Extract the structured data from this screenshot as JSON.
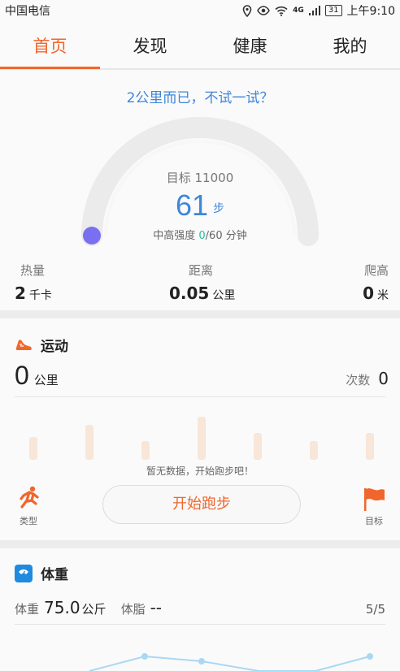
{
  "status_bar": {
    "carrier": "中国电信",
    "network": "4G",
    "calendar_day": "31",
    "time": "上午9:10"
  },
  "tabs": [
    {
      "label": "首页",
      "active": true
    },
    {
      "label": "发现",
      "active": false
    },
    {
      "label": "健康",
      "active": false
    },
    {
      "label": "我的",
      "active": false
    }
  ],
  "steps_card": {
    "hint": "2公里而已，不试一试？",
    "target": "目标 11000",
    "steps": "61",
    "steps_unit": "步",
    "intensity_prefix": "中高强度 ",
    "intensity_value": "0",
    "intensity_suffix": "/60 分钟",
    "progress_fraction": 0.0055
  },
  "metrics": {
    "calories": {
      "label": "热量",
      "value": "2",
      "unit": "千卡"
    },
    "distance": {
      "label": "距离",
      "value": "0.05",
      "unit": "公里"
    },
    "climb": {
      "label": "爬高",
      "value": "0",
      "unit": "米"
    }
  },
  "exercise_card": {
    "title": "运动",
    "distance_value": "0",
    "distance_unit": "公里",
    "count_label": "次数",
    "count_value": "0",
    "no_data": "暂无数据，开始跑步吧！",
    "type_label": "类型",
    "start_label": "开始跑步",
    "goal_label": "目标"
  },
  "weight_card": {
    "title": "体重",
    "weight_label": "体重",
    "weight_value": "75.0",
    "weight_unit": "公斤",
    "fat_label": "体脂",
    "fat_value": "--",
    "count": "5/5"
  },
  "colors": {
    "accent_orange": "#f0662d",
    "accent_blue": "#3e86d9",
    "accent_green": "#21c09c",
    "progress_dot": "#7a6ff0"
  }
}
